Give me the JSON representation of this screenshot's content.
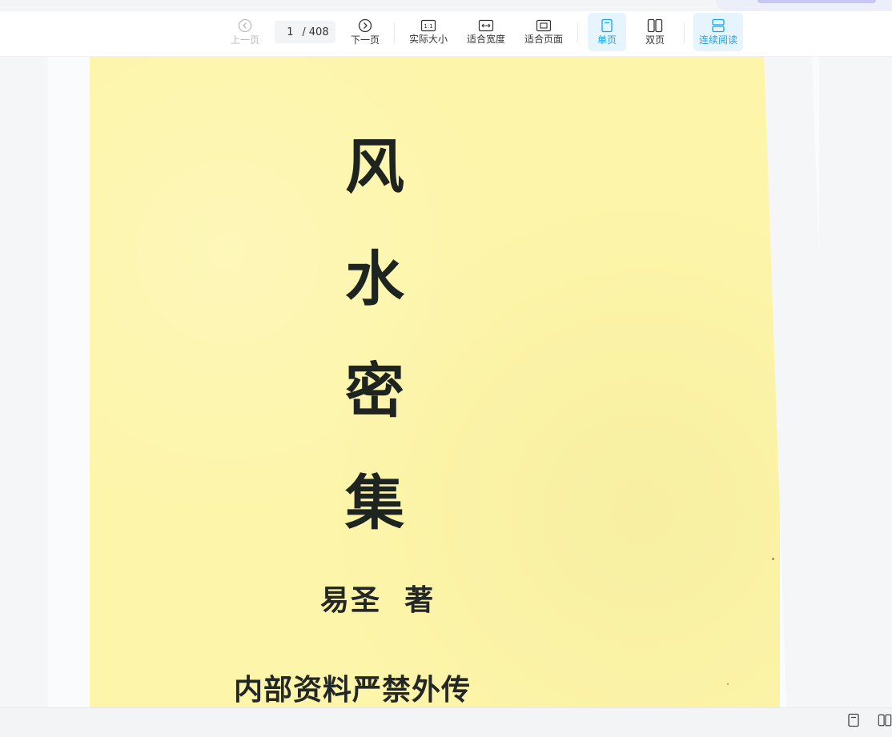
{
  "toolbar": {
    "prev_label": "上一页",
    "next_label": "下一页",
    "current_page": "1",
    "page_separator": "/",
    "total_pages": "408",
    "actual_size_label": "实际大小",
    "actual_size_glyph": "1:1",
    "fit_width_label": "适合宽度",
    "fit_page_label": "适合页面",
    "single_page_label": "单页",
    "double_page_label": "双页",
    "continuous_label": "连续阅读"
  },
  "document": {
    "title_chars": [
      "风",
      "水",
      "密",
      "集"
    ],
    "author": "易圣  著",
    "notice": "内部资料严禁外传"
  },
  "colors": {
    "page_background": "#fdf5a9",
    "accent": "#1aa3e8",
    "active_background": "#e6f4fd",
    "disabled_text": "#b9bcc3"
  }
}
